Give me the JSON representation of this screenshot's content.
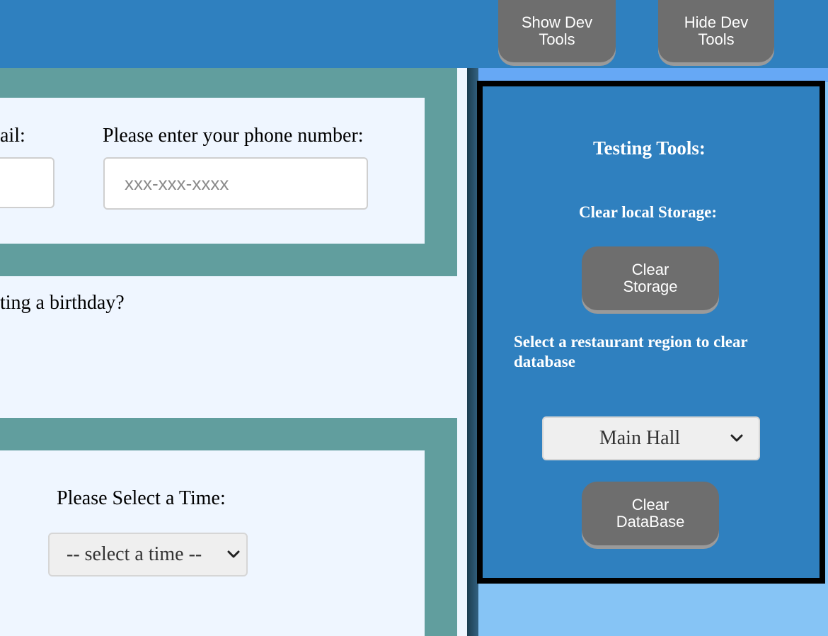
{
  "header": {
    "show_dev_label": "Show Dev\nTools",
    "hide_dev_label": "Hide Dev\nTools"
  },
  "form": {
    "email_label": "ail:",
    "phone_label": "Please enter your phone number:",
    "phone_placeholder": "xxx-xxx-xxxx",
    "birthday_label": "ting a birthday?",
    "time_label": "Please Select a Time:",
    "time_select_value": "-- select a time --"
  },
  "tools": {
    "title": "Testing Tools:",
    "clear_local_label": "Clear local Storage:",
    "clear_storage_button": "Clear\nStorage",
    "region_label": "Select a restaurant region to clear database",
    "region_select_value": "Main Hall",
    "clear_db_button": "Clear\nDataBase"
  },
  "colors": {
    "topbar": "#2f80bf",
    "teal_band": "#619e9e",
    "card_bg": "#eff6ff",
    "tools_panel": "#2f80bf",
    "button_gray": "#6e6e6e",
    "right_bg": "#86c4f5"
  },
  "icons": {
    "select_arrow": "chevron-down-icon"
  }
}
